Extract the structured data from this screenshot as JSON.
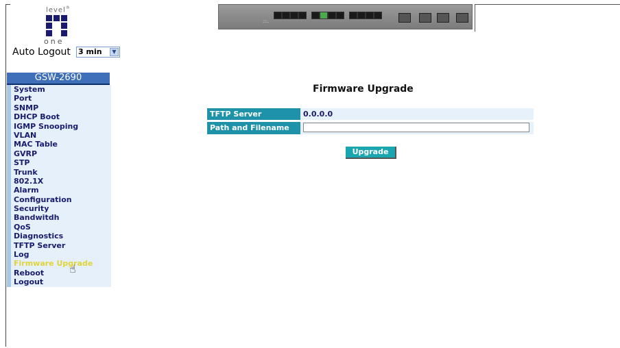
{
  "logo": {
    "top": "level",
    "bottom": "one"
  },
  "auto_logout": {
    "label": "Auto Logout",
    "selected": "3 min"
  },
  "sidebar": {
    "model": "GSW-2690",
    "items": [
      "System",
      "Port",
      "SNMP",
      "DHCP Boot",
      "IGMP Snooping",
      "VLAN",
      "MAC Table",
      "GVRP",
      "STP",
      "Trunk",
      "802.1X",
      "Alarm",
      "Configuration",
      "Security",
      "Bandwitdh",
      "QoS",
      "Diagnostics",
      "TFTP Server",
      "Log",
      "Firmware Upgrade",
      "Reboot",
      "Logout"
    ],
    "active": "Firmware Upgrade"
  },
  "main": {
    "title": "Firmware Upgrade",
    "tftp_server_label": "TFTP Server",
    "tftp_server_value": "0.0.0.0",
    "path_label": "Path and Filename",
    "path_value": "",
    "upgrade_button": "Upgrade"
  },
  "colors": {
    "label_bg": "#1e92a8",
    "sidebar_title_bg": "#3f6fb8",
    "nav_text": "#1a1a6e",
    "active_text": "#e0d43a"
  }
}
